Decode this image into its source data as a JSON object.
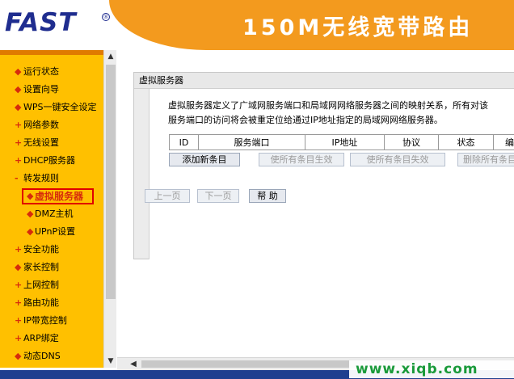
{
  "header": {
    "logo_text": "FAST",
    "logo_reg": "®",
    "title": "150M无线宽带路由"
  },
  "sidebar": {
    "items": [
      {
        "mark": "◆",
        "label": "运行状态"
      },
      {
        "mark": "◆",
        "label": "设置向导"
      },
      {
        "mark": "◆",
        "label": "WPS一键安全设定"
      },
      {
        "mark": "+",
        "label": "网络参数"
      },
      {
        "mark": "+",
        "label": "无线设置"
      },
      {
        "mark": "+",
        "label": "DHCP服务器"
      },
      {
        "mark": "-",
        "label": "转发规则"
      },
      {
        "mark": "◆",
        "label": "虚拟服务器"
      },
      {
        "mark": "◆",
        "label": "DMZ主机"
      },
      {
        "mark": "◆",
        "label": "UPnP设置"
      },
      {
        "mark": "+",
        "label": "安全功能"
      },
      {
        "mark": "◆",
        "label": "家长控制"
      },
      {
        "mark": "+",
        "label": "上网控制"
      },
      {
        "mark": "+",
        "label": "路由功能"
      },
      {
        "mark": "+",
        "label": "IP带宽控制"
      },
      {
        "mark": "+",
        "label": "ARP绑定"
      },
      {
        "mark": "◆",
        "label": "动态DNS"
      }
    ]
  },
  "scroll": {
    "up": "▲",
    "down": "▼",
    "left": "◀",
    "right": "▶"
  },
  "panel": {
    "title": "虚拟服务器",
    "desc_line1": "虚拟服务器定义了广域网服务端口和局域网网络服务器之间的映射关系，所有对该",
    "desc_line2": "服务端口的访问将会被重定位给通过IP地址指定的局域网网络服务器。",
    "columns": [
      "ID",
      "服务端口",
      "IP地址",
      "协议",
      "状态",
      "编"
    ]
  },
  "buttons": {
    "add": "添加新条目",
    "enable_all": "使所有条目生效",
    "disable_all": "使所有条目失效",
    "delete_all": "删除所有条目",
    "prev": "上一页",
    "next": "下一页",
    "help": "帮 助"
  },
  "watermark": "www.xiqb.com"
}
